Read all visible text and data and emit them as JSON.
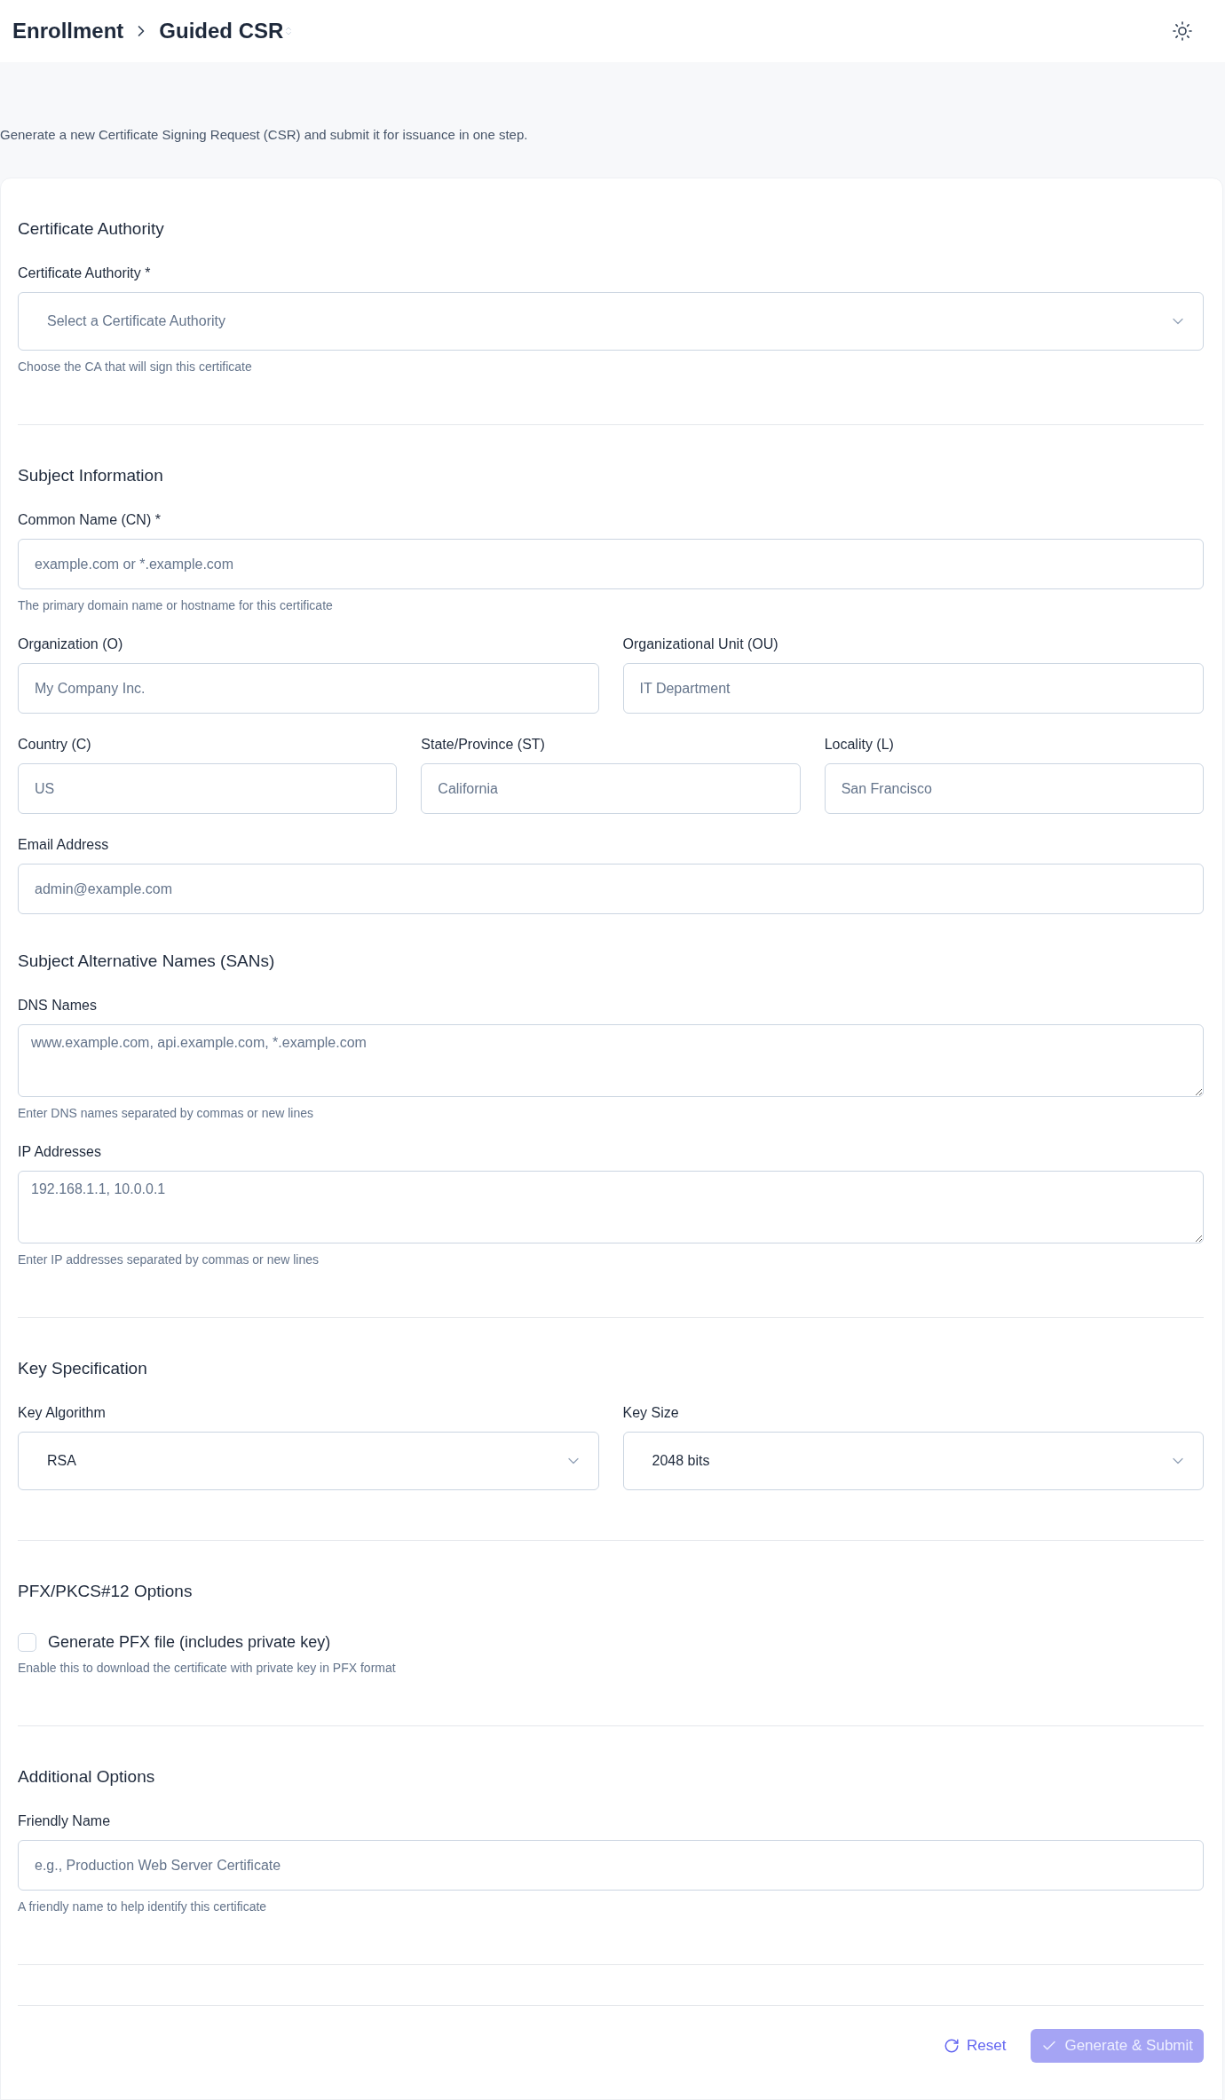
{
  "header": {
    "breadcrumbs": [
      "Enrollment",
      "Guided CSR"
    ]
  },
  "description": "Generate a new Certificate Signing Request (CSR) and submit it for issuance in one step.",
  "sections": [
    {
      "groups": [
        {
          "title": "Certificate Authority",
          "rows": [
            [
              {
                "kind": "select",
                "label": "Certificate Authority *",
                "placeholder": "Select a Certificate Authority",
                "hint": "Choose the CA that will sign this certificate"
              }
            ]
          ]
        }
      ]
    },
    {
      "groups": [
        {
          "title": "Subject Information",
          "rows": [
            [
              {
                "kind": "input",
                "label": "Common Name (CN) *",
                "placeholder": "example.com or *.example.com",
                "hint": "The primary domain name or hostname for this certificate"
              }
            ],
            [
              {
                "kind": "input",
                "label": "Organization (O)",
                "placeholder": "My Company Inc."
              },
              {
                "kind": "input",
                "label": "Organizational Unit (OU)",
                "placeholder": "IT Department"
              }
            ],
            [
              {
                "kind": "input",
                "label": "Country (C)",
                "placeholder": "US"
              },
              {
                "kind": "input",
                "label": "State/Province (ST)",
                "placeholder": "California"
              },
              {
                "kind": "input",
                "label": "Locality (L)",
                "placeholder": "San Francisco"
              }
            ],
            [
              {
                "kind": "input",
                "label": "Email Address",
                "placeholder": "admin@example.com"
              }
            ]
          ]
        },
        {
          "title": "Subject Alternative Names (SANs)",
          "rows": [
            [
              {
                "kind": "textarea",
                "label": "DNS Names",
                "placeholder": "www.example.com, api.example.com, *.example.com",
                "hint": "Enter DNS names separated by commas or new lines"
              }
            ],
            [
              {
                "kind": "textarea",
                "label": "IP Addresses",
                "placeholder": "192.168.1.1, 10.0.0.1",
                "hint": "Enter IP addresses separated by commas or new lines"
              }
            ]
          ]
        }
      ]
    },
    {
      "groups": [
        {
          "title": "Key Specification",
          "rows": [
            [
              {
                "kind": "select",
                "label": "Key Algorithm",
                "value": "RSA"
              },
              {
                "kind": "select",
                "label": "Key Size",
                "value": "2048 bits"
              }
            ]
          ]
        }
      ]
    },
    {
      "groups": [
        {
          "title": "PFX/PKCS#12 Options",
          "rows": [
            [
              {
                "kind": "checkbox",
                "label": "Generate PFX file (includes private key)",
                "checked": false,
                "hint": "Enable this to download the certificate with private key in PFX format"
              }
            ]
          ]
        }
      ]
    },
    {
      "groups": [
        {
          "title": "Additional Options",
          "rows": [
            [
              {
                "kind": "input",
                "label": "Friendly Name",
                "placeholder": "e.g., Production Web Server Certificate",
                "hint": "A friendly name to help identify this certificate"
              }
            ]
          ]
        }
      ]
    }
  ],
  "actions": [
    {
      "kind": "reset",
      "label": "Reset"
    },
    {
      "kind": "submit",
      "label": "Generate & Submit",
      "disabled": true
    }
  ]
}
